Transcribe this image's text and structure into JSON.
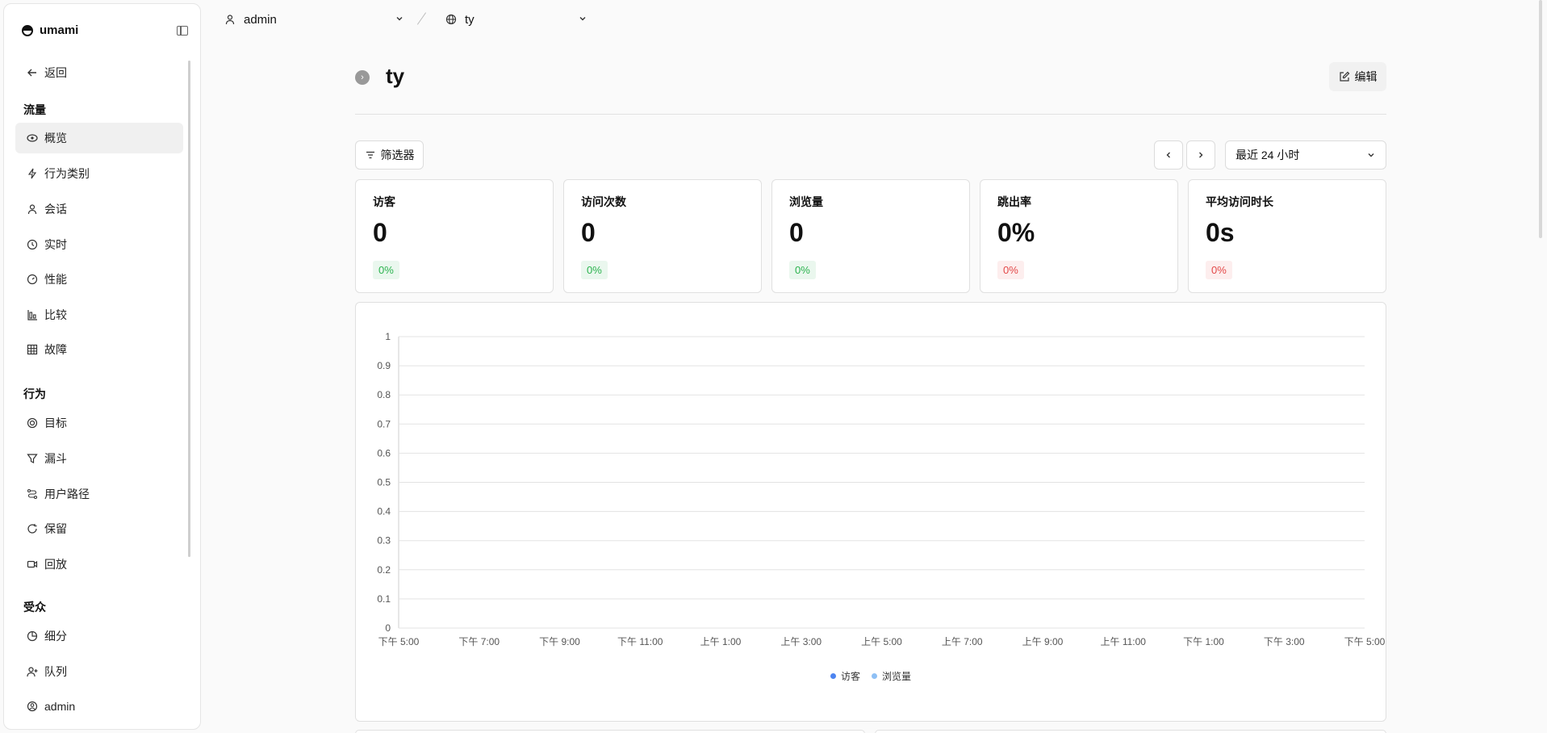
{
  "sidebar": {
    "brand": "umami",
    "back": "返回",
    "sections": [
      {
        "title": "流量",
        "items": [
          {
            "label": "概览",
            "icon": "eye-icon",
            "active": true
          },
          {
            "label": "行为类别",
            "icon": "bolt-icon"
          },
          {
            "label": "会话",
            "icon": "user-icon"
          },
          {
            "label": "实时",
            "icon": "clock-icon"
          },
          {
            "label": "性能",
            "icon": "gauge-icon"
          },
          {
            "label": "比较",
            "icon": "bar-compare-icon"
          },
          {
            "label": "故障",
            "icon": "grid-icon"
          }
        ]
      },
      {
        "title": "行为",
        "items": [
          {
            "label": "目标",
            "icon": "target-icon"
          },
          {
            "label": "漏斗",
            "icon": "funnel-icon"
          },
          {
            "label": "用户路径",
            "icon": "path-icon"
          },
          {
            "label": "保留",
            "icon": "retention-icon"
          },
          {
            "label": "回放",
            "icon": "video-icon"
          }
        ]
      },
      {
        "title": "受众",
        "items": [
          {
            "label": "细分",
            "icon": "pie-icon"
          },
          {
            "label": "队列",
            "icon": "user-plus-icon"
          }
        ]
      }
    ],
    "user": "admin"
  },
  "topbar": {
    "team": "admin",
    "website": "ty"
  },
  "header": {
    "title": "ty",
    "edit_label": "编辑"
  },
  "controls": {
    "filter_label": "筛选器",
    "range": "最近 24 小时"
  },
  "metrics": [
    {
      "label": "访客",
      "value": "0",
      "change": "0%",
      "trend": "up"
    },
    {
      "label": "访问次数",
      "value": "0",
      "change": "0%",
      "trend": "up"
    },
    {
      "label": "浏览量",
      "value": "0",
      "change": "0%",
      "trend": "up"
    },
    {
      "label": "跳出率",
      "value": "0%",
      "change": "0%",
      "trend": "down"
    },
    {
      "label": "平均访问时长",
      "value": "0s",
      "change": "0%",
      "trend": "down"
    }
  ],
  "colors": {
    "visitors": "#4d84f0",
    "views": "#8ec0f5",
    "up": "#2bb34e",
    "down": "#e34848"
  },
  "chart_data": {
    "type": "bar",
    "categories": [
      "下午 5:00",
      "下午 7:00",
      "下午 9:00",
      "下午 11:00",
      "上午 1:00",
      "上午 3:00",
      "上午 5:00",
      "上午 7:00",
      "上午 9:00",
      "上午 11:00",
      "下午 1:00",
      "下午 3:00",
      "下午 5:00"
    ],
    "yticks": [
      "0",
      "0.1",
      "0.2",
      "0.3",
      "0.4",
      "0.5",
      "0.6",
      "0.7",
      "0.8",
      "0.9",
      "1"
    ],
    "ylim": [
      0,
      1
    ],
    "grid": true,
    "legend": "bottom",
    "series": [
      {
        "name": "访客",
        "values": [
          0,
          0,
          0,
          0,
          0,
          0,
          0,
          0,
          0,
          0,
          0,
          0,
          0
        ]
      },
      {
        "name": "浏览量",
        "values": [
          0,
          0,
          0,
          0,
          0,
          0,
          0,
          0,
          0,
          0,
          0,
          0,
          0
        ]
      }
    ]
  }
}
